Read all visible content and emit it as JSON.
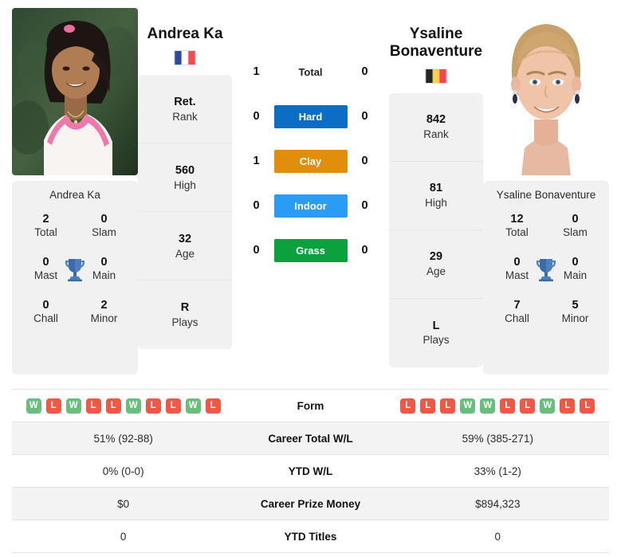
{
  "players": {
    "left": {
      "name": "Andrea Ka",
      "country": "France",
      "flag": "fr-flag-icon",
      "card_name": "Andrea Ka",
      "rank": "Ret.",
      "rank_label": "Rank",
      "high": "560",
      "high_label": "High",
      "age": "32",
      "age_label": "Age",
      "plays": "R",
      "plays_label": "Plays",
      "titles": {
        "total": "2",
        "total_label": "Total",
        "slam": "0",
        "slam_label": "Slam",
        "mast": "0",
        "mast_label": "Mast",
        "main": "0",
        "main_label": "Main",
        "chall": "0",
        "chall_label": "Chall",
        "minor": "2",
        "minor_label": "Minor"
      },
      "form": [
        "W",
        "L",
        "W",
        "L",
        "L",
        "W",
        "L",
        "L",
        "W",
        "L"
      ],
      "career_wl": "51% (92-88)",
      "ytd_wl": "0% (0-0)",
      "prize_money": "$0",
      "ytd_titles": "0"
    },
    "right": {
      "name": "Ysaline Bonaventure",
      "name_line1": "Ysaline",
      "name_line2": "Bonaventure",
      "country": "Belgium",
      "flag": "be-flag-icon",
      "card_name": "Ysaline Bonaventure",
      "rank": "842",
      "rank_label": "Rank",
      "high": "81",
      "high_label": "High",
      "age": "29",
      "age_label": "Age",
      "plays": "L",
      "plays_label": "Plays",
      "titles": {
        "total": "12",
        "total_label": "Total",
        "slam": "0",
        "slam_label": "Slam",
        "mast": "0",
        "mast_label": "Mast",
        "main": "0",
        "main_label": "Main",
        "chall": "7",
        "chall_label": "Chall",
        "minor": "5",
        "minor_label": "Minor"
      },
      "form": [
        "L",
        "L",
        "L",
        "W",
        "W",
        "L",
        "L",
        "W",
        "L",
        "L"
      ],
      "career_wl": "59% (385-271)",
      "ytd_wl": "33% (1-2)",
      "prize_money": "$894,323",
      "ytd_titles": "0"
    }
  },
  "head_to_head": {
    "rows": [
      {
        "label": "Total",
        "left": "1",
        "right": "0",
        "color": "",
        "pill": false
      },
      {
        "label": "Hard",
        "left": "0",
        "right": "0",
        "color": "#0b6ec4",
        "pill": true
      },
      {
        "label": "Clay",
        "left": "1",
        "right": "0",
        "color": "#e08e0b",
        "pill": true
      },
      {
        "label": "Indoor",
        "left": "0",
        "right": "0",
        "color": "#2b9cf5",
        "pill": true
      },
      {
        "label": "Grass",
        "left": "0",
        "right": "0",
        "color": "#0ca03f",
        "pill": true
      }
    ]
  },
  "comparison_table": {
    "rows": [
      {
        "label": "Form",
        "type": "form",
        "shade": false
      },
      {
        "label": "Career Total W/L",
        "type": "text",
        "shade": true,
        "key": "career_wl"
      },
      {
        "label": "YTD W/L",
        "type": "text",
        "shade": false,
        "key": "ytd_wl"
      },
      {
        "label": "Career Prize Money",
        "type": "text",
        "shade": true,
        "key": "prize_money"
      },
      {
        "label": "YTD Titles",
        "type": "text",
        "shade": false,
        "key": "ytd_titles"
      }
    ]
  },
  "colors": {
    "win_badge": "#68bf7b",
    "loss_badge": "#ef5844",
    "trophy": "#3b71b0",
    "card_bg": "#f1f1f1",
    "row_shade": "#f3f3f3"
  }
}
